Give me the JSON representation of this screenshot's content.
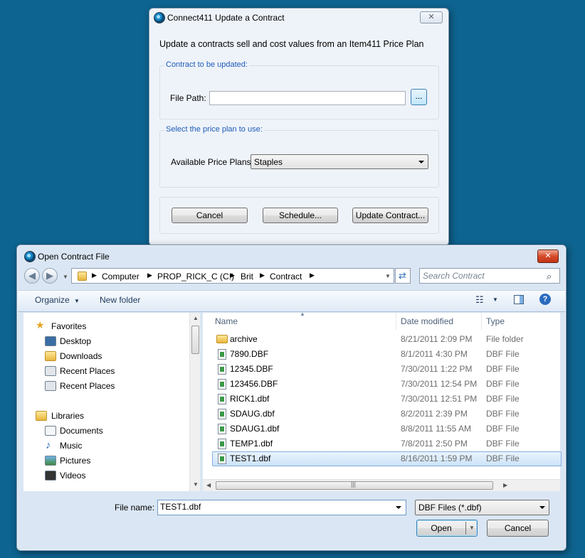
{
  "update_dialog": {
    "title": "Connect411 Update a Contract",
    "close_symbol": "✕",
    "intro": "Update a contracts sell and cost values from an Item411 Price Plan",
    "group_contract": {
      "legend": "Contract to be updated:",
      "file_path_label": "File Path:",
      "file_path_value": "",
      "browse_label": "..."
    },
    "group_plan": {
      "legend": "Select the price plan to use:",
      "plans_label": "Available Price Plans:",
      "selected_plan": "Staples"
    },
    "buttons": {
      "cancel": "Cancel",
      "schedule": "Schedule...",
      "update": "Update Contract..."
    }
  },
  "file_dialog": {
    "title": "Open Contract File",
    "close_symbol": "✕",
    "breadcrumb": [
      "Computer",
      "PROP_RICK_C (C:)",
      "Brit",
      "Contract"
    ],
    "search_placeholder": "Search Contract",
    "toolbar": {
      "organize": "Organize",
      "new_folder": "New folder"
    },
    "nav": {
      "favorites_header": "Favorites",
      "favorites": [
        "Desktop",
        "Downloads",
        "Recent Places",
        "Recent Places"
      ],
      "libraries_header": "Libraries",
      "libraries": [
        "Documents",
        "Music",
        "Pictures",
        "Videos"
      ]
    },
    "columns": {
      "name": "Name",
      "date": "Date modified",
      "type": "Type"
    },
    "files": [
      {
        "name": "archive",
        "date": "8/21/2011 2:09 PM",
        "type": "File folder",
        "kind": "folder"
      },
      {
        "name": "7890.DBF",
        "date": "8/1/2011 4:30 PM",
        "type": "DBF File",
        "kind": "file"
      },
      {
        "name": "12345.DBF",
        "date": "7/30/2011 1:22 PM",
        "type": "DBF File",
        "kind": "file"
      },
      {
        "name": "123456.DBF",
        "date": "7/30/2011 12:54 PM",
        "type": "DBF File",
        "kind": "file"
      },
      {
        "name": "RICK1.dbf",
        "date": "7/30/2011 12:51 PM",
        "type": "DBF File",
        "kind": "file"
      },
      {
        "name": "SDAUG.dbf",
        "date": "8/2/2011 2:39 PM",
        "type": "DBF File",
        "kind": "file"
      },
      {
        "name": "SDAUG1.dbf",
        "date": "8/8/2011 11:55 AM",
        "type": "DBF File",
        "kind": "file"
      },
      {
        "name": "TEMP1.dbf",
        "date": "7/8/2011 2:50 PM",
        "type": "DBF File",
        "kind": "file"
      },
      {
        "name": "TEST1.dbf",
        "date": "8/16/2011 1:59 PM",
        "type": "DBF File",
        "kind": "file",
        "selected": true
      }
    ],
    "file_name_label": "File name:",
    "file_name_value": "TEST1.dbf",
    "filter_value": "DBF Files (*.dbf)",
    "open_label": "Open",
    "cancel_label": "Cancel"
  }
}
